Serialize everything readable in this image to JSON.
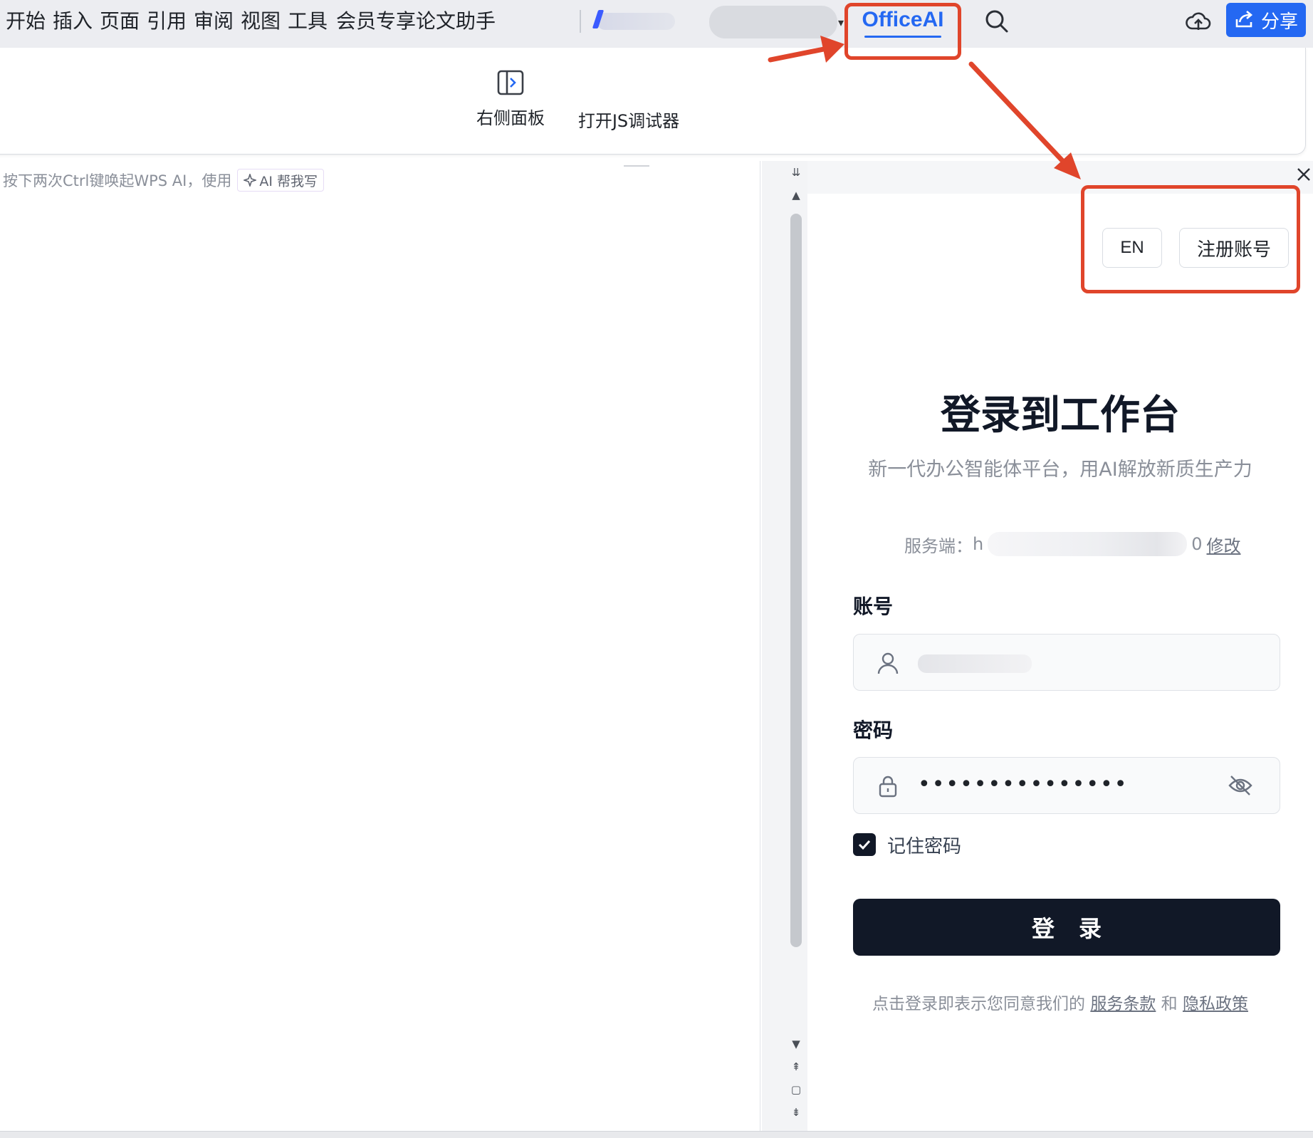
{
  "menu": {
    "tabs": [
      "开始",
      "插入",
      "页面",
      "引用",
      "审阅",
      "视图",
      "工具",
      "会员专享",
      "论文助手"
    ],
    "officeai_tab": "OfficeAI",
    "share_label": "分享"
  },
  "ribbon": {
    "right_panel_label": "右侧面板",
    "js_debugger_label": "打开JS调试器"
  },
  "document": {
    "hint_text": "按下两次Ctrl键唤起WPS AI，使用",
    "ai_write_label": "AI 帮我写"
  },
  "login": {
    "lang_label": "EN",
    "register_label": "注册账号",
    "title": "登录到工作台",
    "subtitle": "新一代办公智能体平台，用AI解放新质生产力",
    "server_label": "服务端：",
    "server_prefix": "h",
    "server_suffix": "0",
    "server_edit": "修改",
    "account_label": "账号",
    "password_label": "密码",
    "password_mask": "•••••••••••••••",
    "remember_label": "记住密码",
    "remember_checked": true,
    "submit_label": "登录",
    "terms_prefix": "点击登录即表示您同意我们的 ",
    "terms_service": "服务条款",
    "terms_and": " 和 ",
    "terms_privacy": "隐私政策"
  },
  "colors": {
    "accent": "#2468f2",
    "annotation": "#e0452b",
    "primary_button": "#111827"
  }
}
